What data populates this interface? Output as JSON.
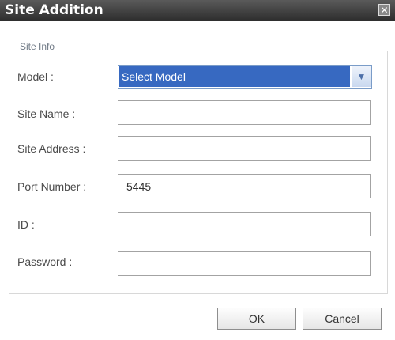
{
  "dialog": {
    "title": "Site Addition",
    "close_glyph": "✕"
  },
  "group": {
    "title": "Site Info"
  },
  "fields": {
    "model": {
      "label": "Model :",
      "value": "Select Model"
    },
    "site_name": {
      "label": "Site Name :",
      "value": ""
    },
    "site_address": {
      "label": "Site Address :",
      "value": ""
    },
    "port_number": {
      "label": "Port Number :",
      "value": "5445"
    },
    "id": {
      "label": "ID :",
      "value": ""
    },
    "password": {
      "label": "Password :",
      "value": ""
    }
  },
  "buttons": {
    "ok": "OK",
    "cancel": "Cancel"
  },
  "icons": {
    "dropdown": "chevron-down-icon",
    "close": "close-icon"
  },
  "colors": {
    "titlebar": "#3a3a3a",
    "selection": "#3769c1"
  }
}
